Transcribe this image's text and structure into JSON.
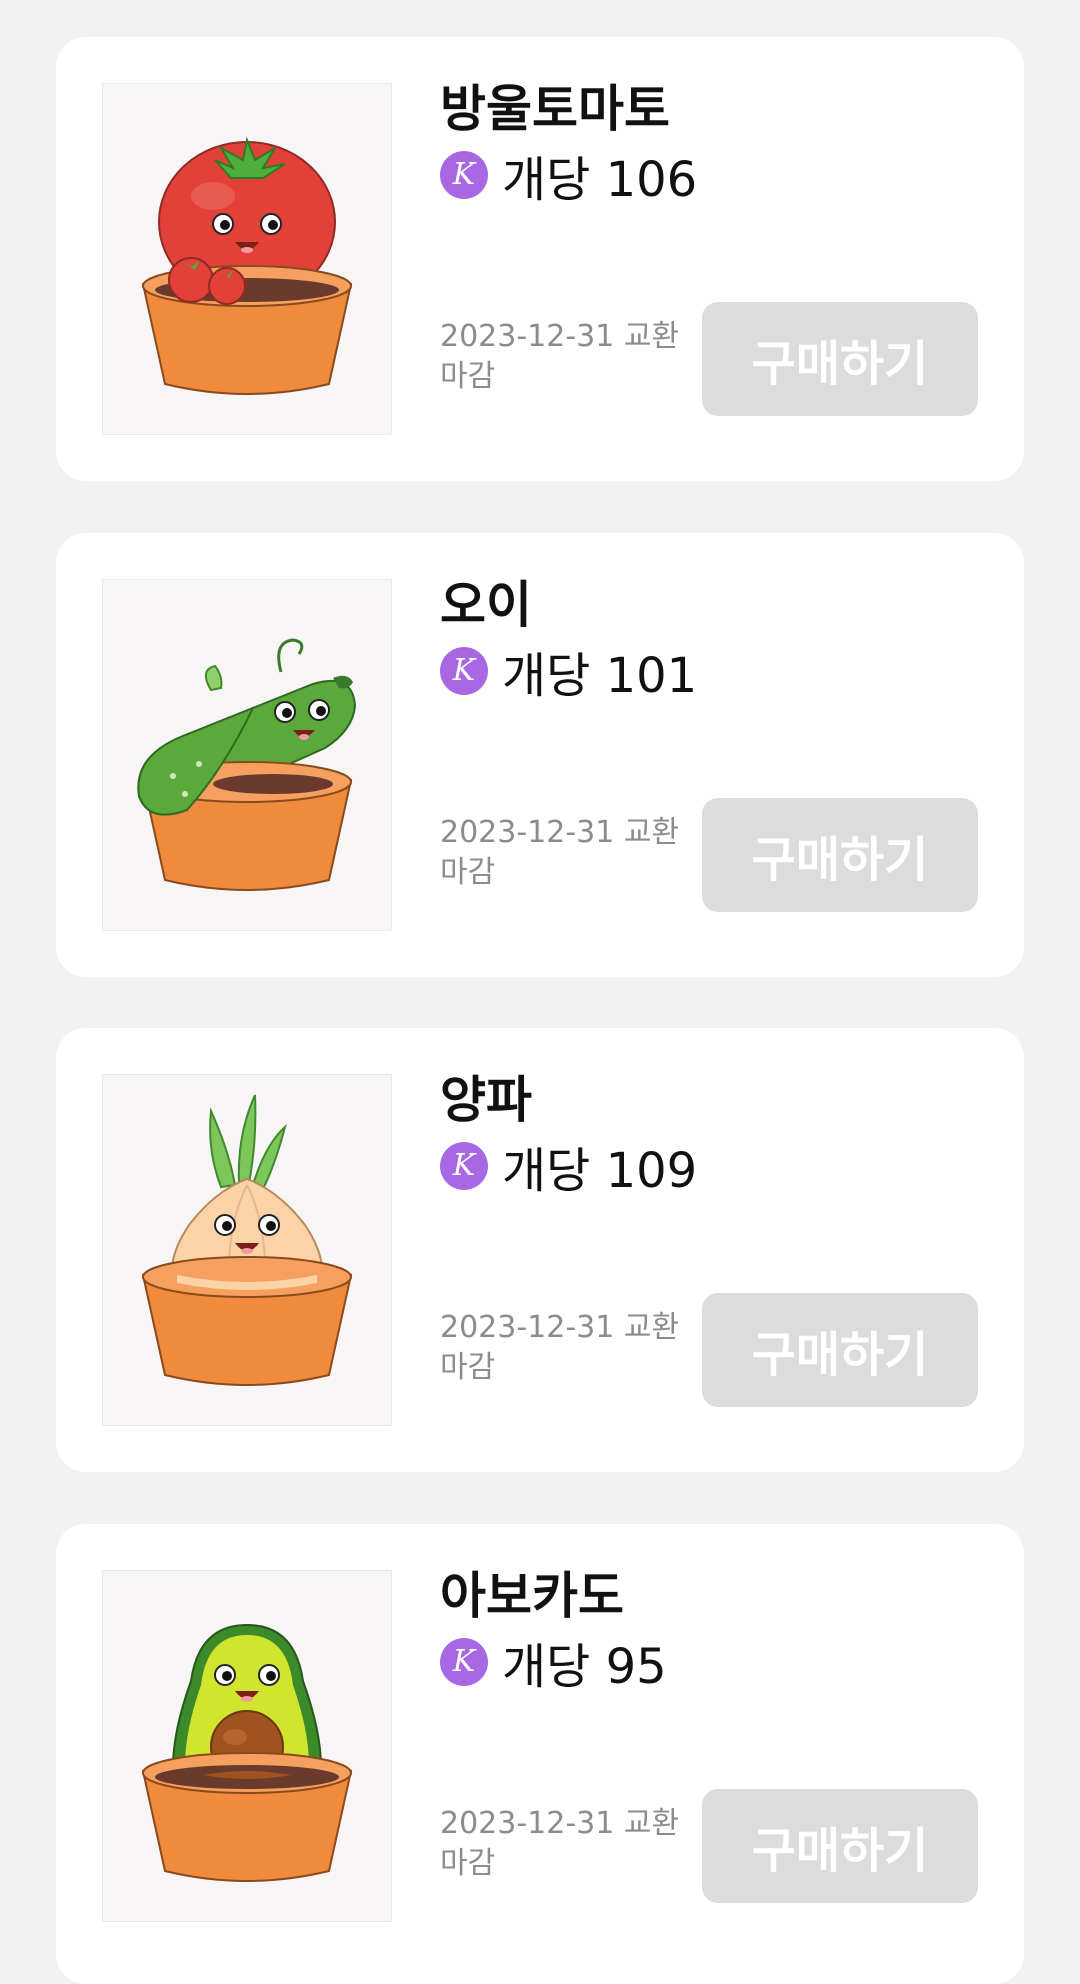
{
  "items": [
    {
      "name": "방울토마토",
      "price_label": "개당 106",
      "coin_symbol": "K",
      "deadline": "2023-12-31 교환 마감",
      "buy_label": "구매하기",
      "image_icon": "cherry-tomato-pot-icon"
    },
    {
      "name": "오이",
      "price_label": "개당 101",
      "coin_symbol": "K",
      "deadline": "2023-12-31 교환 마감",
      "buy_label": "구매하기",
      "image_icon": "cucumber-pot-icon"
    },
    {
      "name": "양파",
      "price_label": "개당 109",
      "coin_symbol": "K",
      "deadline": "2023-12-31 교환 마감",
      "buy_label": "구매하기",
      "image_icon": "onion-pot-icon"
    },
    {
      "name": "아보카도",
      "price_label": "개당 95",
      "coin_symbol": "K",
      "deadline": "2023-12-31 교환 마감",
      "buy_label": "구매하기",
      "image_icon": "avocado-pot-icon"
    }
  ],
  "colors": {
    "background": "#f2f2f2",
    "card": "#ffffff",
    "coin": "#a868e4",
    "button_disabled": "#dcdcdc",
    "deadline_text": "#8c8c8c",
    "pot": "#f08a3c"
  }
}
